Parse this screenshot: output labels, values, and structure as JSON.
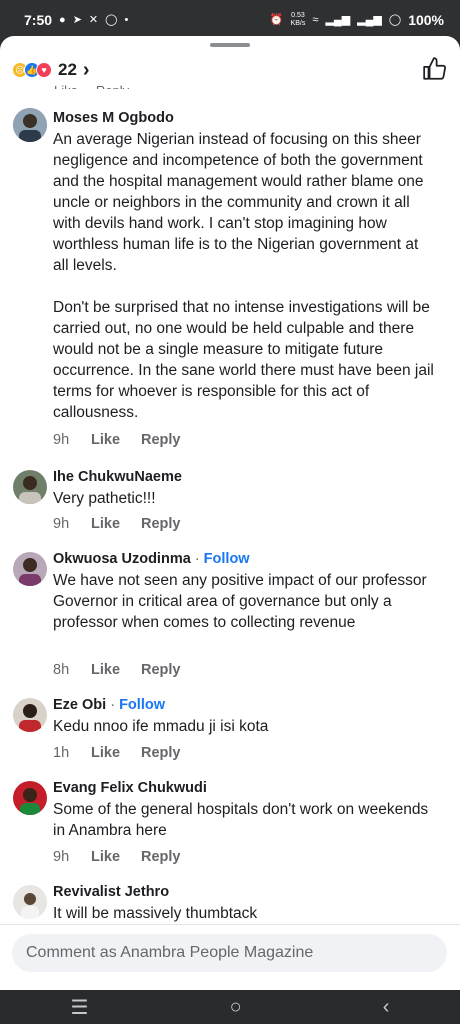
{
  "status_bar": {
    "time": "7:50",
    "net_speed": "0.53",
    "net_unit": "KB/s",
    "battery": "100%"
  },
  "reactions": {
    "count": "22",
    "icons": [
      "sad-reaction",
      "like-reaction",
      "love-reaction"
    ]
  },
  "comments": [
    {
      "author": "Moses M Ogbodo",
      "follow": "",
      "text": "An average Nigerian instead of focusing on this sheer negligence and incompetence of both the government and the hospital management would rather blame one uncle or neighbors in the community and crown it all with devils hand work. I can't stop imagining how worthless human life is to the Nigerian government at all levels.\n\nDon't be surprised that no intense investigations will be carried out, no one would be held culpable and there would not be a single measure to mitigate future occurrence. In the sane world there must have been jail terms for whoever is responsible for this act of callousness.",
      "time": "9h",
      "like": "Like",
      "reply": "Reply"
    },
    {
      "author": "Ihe ChukwuNaeme",
      "follow": "",
      "text": "Very pathetic!!!",
      "time": "9h",
      "like": "Like",
      "reply": "Reply"
    },
    {
      "author": "Okwuosa Uzodinma",
      "follow": "Follow",
      "text": "We have not seen any positive impact of our professor Governor in critical area of governance but only a professor when comes to collecting revenue",
      "time": "8h",
      "like": "Like",
      "reply": "Reply"
    },
    {
      "author": "Eze Obi",
      "follow": "Follow",
      "text": "Kedu nnoo ife mmadu ji isi kota",
      "time": "1h",
      "like": "Like",
      "reply": "Reply"
    },
    {
      "author": "Evang Felix Chukwudi",
      "follow": "",
      "text": "Some of the general hospitals don't work on weekends in Anambra here",
      "time": "9h",
      "like": "Like",
      "reply": "Reply"
    },
    {
      "author": "Revivalist Jethro",
      "follow": "",
      "text": "It will be massively thumbtack",
      "time": "",
      "like": "",
      "reply": ""
    }
  ],
  "composer": {
    "placeholder": "Comment as Anambra People Magazine"
  },
  "colors": {
    "accent": "#1877f2",
    "meta": "#65676b",
    "text": "#1c1e21"
  }
}
